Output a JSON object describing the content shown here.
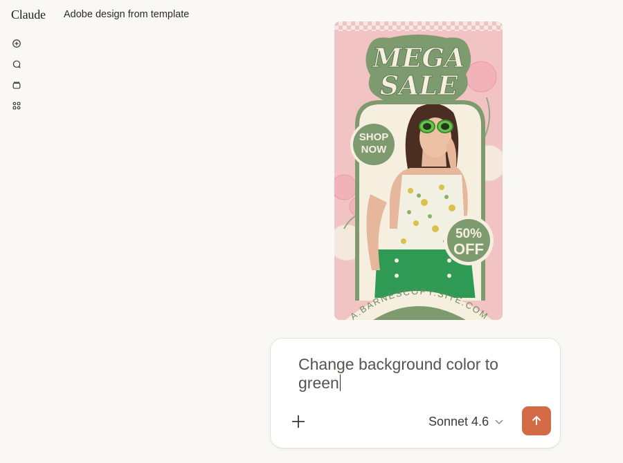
{
  "app": {
    "brand": "Claude",
    "chat_title": "Adobe design from template"
  },
  "rail": {
    "icons": [
      "new-chat-icon",
      "chats-icon",
      "projects-icon",
      "artifacts-icon"
    ]
  },
  "poster": {
    "title_line1": "MEGA",
    "title_line2": "SALE",
    "shop_line1": "SHOP",
    "shop_line2": "NOW",
    "discount_line1": "50%",
    "discount_line2": "OFF",
    "website": "A.BARNESCOPY.SITE.COM",
    "colors": {
      "background": "#f2c3c3",
      "accent_green": "#7e9a6f",
      "cream": "#f6efdf",
      "pants_green": "#2f9a54"
    }
  },
  "composer": {
    "text": "Change background color to green",
    "model_label": "Sonnet 4.6",
    "send_color": "#d36b47"
  }
}
